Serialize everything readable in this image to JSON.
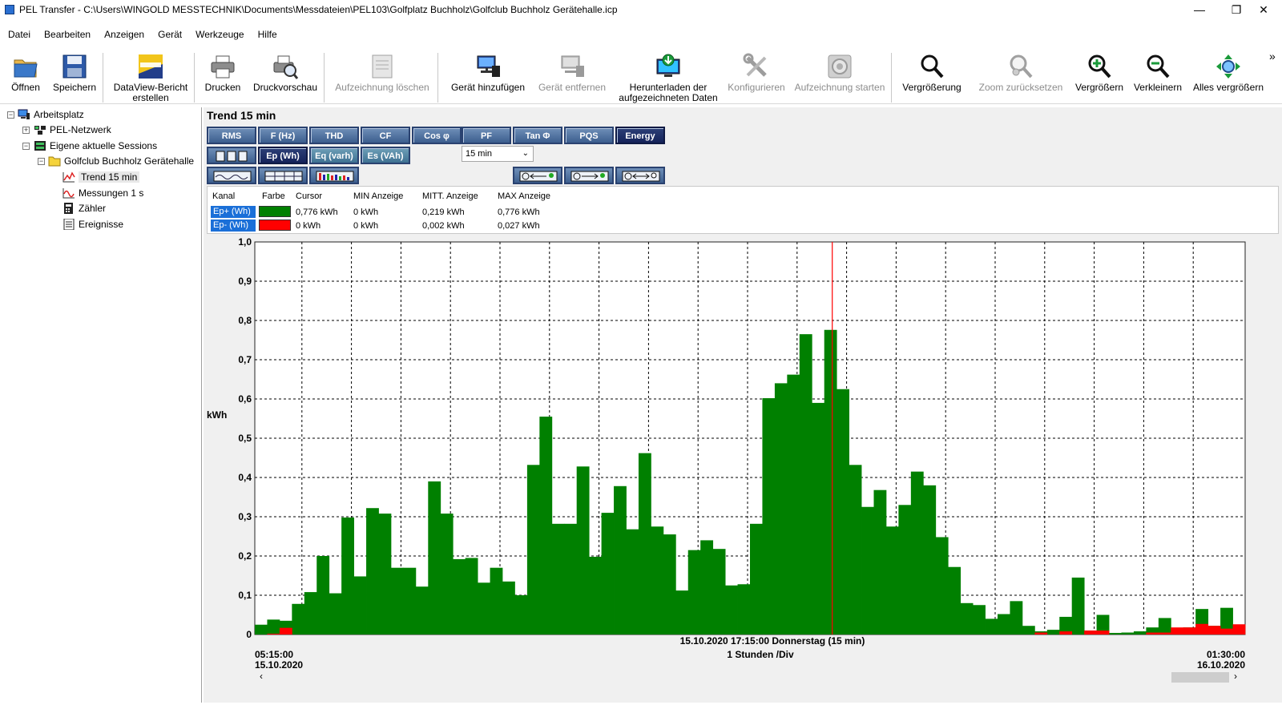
{
  "window": {
    "title": "PEL Transfer - C:\\Users\\WINGOLD MESSTECHNIK\\Documents\\Messdateien\\PEL103\\Golfplatz Buchholz\\Golfclub Buchholz Gerätehalle.icp",
    "minimize_glyph": "—",
    "maximize_glyph": "❐",
    "close_glyph": "✕"
  },
  "menu": [
    "Datei",
    "Bearbeiten",
    "Anzeigen",
    "Gerät",
    "Werkzeuge",
    "Hilfe"
  ],
  "toolbar": {
    "open": "Öffnen",
    "save": "Speichern",
    "dataview_line1": "DataView-Bericht",
    "dataview_line2": "erstellen",
    "print": "Drucken",
    "preview": "Druckvorschau",
    "delete_rec": "Aufzeichnung löschen",
    "add_device": "Gerät hinzufügen",
    "remove_device": "Gerät entfernen",
    "download_line1": "Herunterladen der",
    "download_line2": "aufgezeichneten Daten",
    "configure": "Konfigurieren",
    "start_rec": "Aufzeichnung starten",
    "magnify": "Vergrößerung",
    "zoom_reset": "Zoom zurücksetzen",
    "zoom_in": "Vergrößern",
    "zoom_out": "Verkleinern",
    "zoom_all": "Alles vergrößern",
    "overflow_glyph": "»"
  },
  "tree": {
    "root": "Arbeitsplatz",
    "network": "PEL-Netzwerk",
    "sessions": "Eigene aktuelle Sessions",
    "site": "Golfclub Buchholz Gerätehalle",
    "trend": "Trend 15 min",
    "meas": "Messungen 1 s",
    "counter": "Zähler",
    "events": "Ereignisse"
  },
  "panel": {
    "title": "Trend 15 min",
    "row1": [
      "RMS",
      "F (Hz)",
      "THD",
      "CF",
      "Cos φ",
      "PF",
      "Tan Φ",
      "PQS",
      "Energy"
    ],
    "row2": [
      "Ep (Wh)",
      "Eq (varh)",
      "Es (VAh)"
    ],
    "interval": "15 min"
  },
  "table": {
    "headers": [
      "Kanal",
      "Farbe",
      "Cursor",
      "MIN Anzeige",
      "MITT. Anzeige",
      "MAX Anzeige"
    ],
    "rows": [
      {
        "channel": "Ep+ (Wh)",
        "color": "#008000",
        "cursor": "0,776 kWh",
        "min": "0 kWh",
        "avg": "0,219 kWh",
        "max": "0,776 kWh"
      },
      {
        "channel": "Ep- (Wh)",
        "color": "#ff0000",
        "cursor": "0 kWh",
        "min": "0 kWh",
        "avg": "0,002 kWh",
        "max": "0,027 kWh"
      }
    ]
  },
  "chart_data": {
    "type": "bar",
    "ylabel": "kWh",
    "ylim": [
      0,
      1.0
    ],
    "yticks": [
      "0",
      "0,1",
      "0,2",
      "0,3",
      "0,4",
      "0,5",
      "0,6",
      "0,7",
      "0,8",
      "0,9",
      "1,0"
    ],
    "x_start_time": "05:15:00",
    "x_start_date": "15.10.2020",
    "x_end_time": "01:30:00",
    "x_end_date": "16.10.2020",
    "cursor_label": "15.10.2020 17:15:00 Donnerstag (15 min)",
    "division": "1 Stunden /Div",
    "grid": true,
    "series": [
      {
        "name": "Ep+ (Wh)",
        "color": "#008000",
        "values": [
          0.025,
          0.038,
          0.035,
          0.078,
          0.108,
          0.2,
          0.105,
          0.298,
          0.148,
          0.322,
          0.308,
          0.17,
          0.17,
          0.122,
          0.39,
          0.308,
          0.192,
          0.195,
          0.132,
          0.17,
          0.135,
          0.1,
          0.432,
          0.555,
          0.282,
          0.282,
          0.428,
          0.198,
          0.31,
          0.378,
          0.268,
          0.462,
          0.275,
          0.255,
          0.112,
          0.215,
          0.24,
          0.218,
          0.125,
          0.128,
          0.282,
          0.602,
          0.64,
          0.662,
          0.765,
          0.59,
          0.776,
          0.625,
          0.432,
          0.325,
          0.368,
          0.275,
          0.33,
          0.415,
          0.38,
          0.248,
          0.172,
          0.08,
          0.075,
          0.04,
          0.052,
          0.085,
          0.022,
          0.008,
          0.012,
          0.045,
          0.145,
          0.01,
          0.05,
          0.004,
          0.005,
          0.008,
          0.018,
          0.042,
          0.01,
          0.018,
          0.065,
          0.022,
          0.068,
          0.012
        ]
      },
      {
        "name": "Ep- (Wh)",
        "color": "#ff0000",
        "values": [
          0,
          0.002,
          0.017,
          0,
          0,
          0,
          0,
          0,
          0,
          0,
          0,
          0,
          0,
          0,
          0,
          0,
          0,
          0,
          0,
          0,
          0,
          0,
          0,
          0,
          0,
          0,
          0,
          0,
          0,
          0,
          0,
          0,
          0,
          0,
          0,
          0,
          0,
          0,
          0,
          0,
          0,
          0,
          0,
          0,
          0,
          0,
          0,
          0,
          0,
          0,
          0,
          0,
          0,
          0,
          0,
          0,
          0,
          0,
          0,
          0,
          0,
          0,
          0,
          0.005,
          0,
          0.008,
          0,
          0.01,
          0.01,
          0,
          0,
          0,
          0.005,
          0.005,
          0.018,
          0.018,
          0.027,
          0.022,
          0.015,
          0.026
        ]
      }
    ],
    "cursor_index": 46
  }
}
